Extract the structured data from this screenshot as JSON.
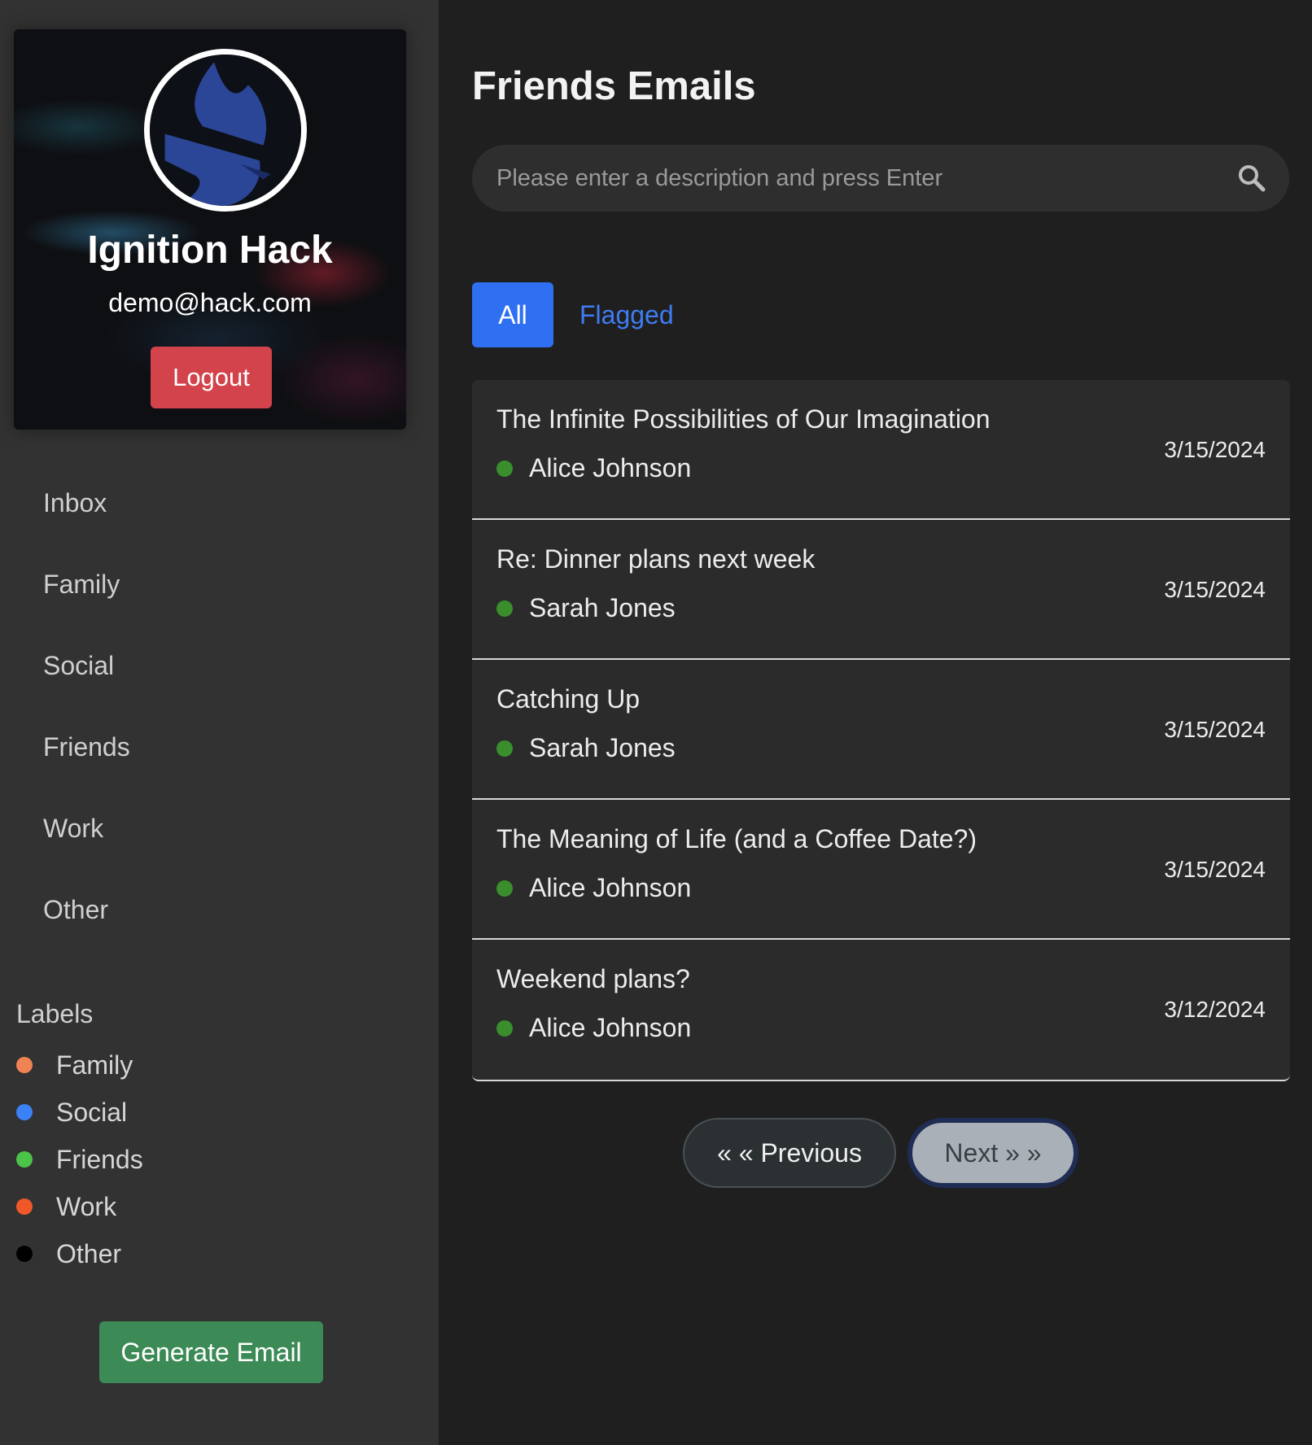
{
  "profile": {
    "name": "Ignition Hack",
    "email": "demo@hack.com",
    "logout_label": "Logout"
  },
  "nav": {
    "items": [
      {
        "label": "Inbox"
      },
      {
        "label": "Family"
      },
      {
        "label": "Social"
      },
      {
        "label": "Friends"
      },
      {
        "label": "Work"
      },
      {
        "label": "Other"
      }
    ]
  },
  "labels": {
    "title": "Labels",
    "items": [
      {
        "label": "Family",
        "color": "#ef8354"
      },
      {
        "label": "Social",
        "color": "#3b82f6"
      },
      {
        "label": "Friends",
        "color": "#4cc44a"
      },
      {
        "label": "Work",
        "color": "#f0582a"
      },
      {
        "label": "Other",
        "color": "#000000"
      }
    ]
  },
  "generate_label": "Generate Email",
  "main": {
    "title": "Friends Emails",
    "search_placeholder": "Please enter a description and press Enter",
    "tabs": {
      "all": "All",
      "flagged": "Flagged"
    },
    "emails": [
      {
        "subject": "The Infinite Possibilities of Our Imagination",
        "sender": "Alice Johnson",
        "date": "3/15/2024"
      },
      {
        "subject": "Re: Dinner plans next week",
        "sender": "Sarah Jones",
        "date": "3/15/2024"
      },
      {
        "subject": "Catching Up",
        "sender": "Sarah Jones",
        "date": "3/15/2024"
      },
      {
        "subject": "The Meaning of Life (and a Coffee Date?)",
        "sender": "Alice Johnson",
        "date": "3/15/2024"
      },
      {
        "subject": "Weekend plans?",
        "sender": "Alice Johnson",
        "date": "3/12/2024"
      }
    ],
    "pagination": {
      "previous": "« « Previous",
      "next": "Next » »"
    }
  },
  "colors": {
    "accent": "#2f6ff2",
    "logout": "#d2434b",
    "generate": "#3c8a55",
    "status_online": "#3a8f2c"
  }
}
